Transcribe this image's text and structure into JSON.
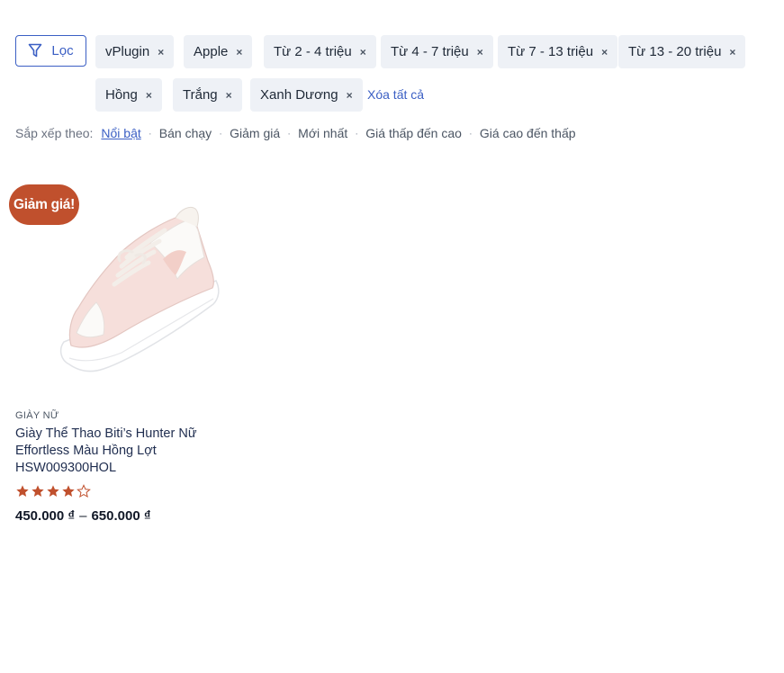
{
  "filter": {
    "label": "Lọc",
    "accent": "#3b5fc4"
  },
  "chips": [
    {
      "label": "vPlugin"
    },
    {
      "label": "Apple"
    },
    {
      "label": "Từ 2 - 4 triệu"
    },
    {
      "label": "Từ 4 - 7 triệu"
    },
    {
      "label": "Từ 7 - 13 triệu"
    },
    {
      "label": "Từ 13 - 20 triệu"
    },
    {
      "label": "Hồng"
    },
    {
      "label": "Trắng"
    },
    {
      "label": "Xanh Dương"
    }
  ],
  "remove_symbol": "×",
  "clear_all": "Xóa tất cả",
  "sort": {
    "label": "Sắp xếp theo:",
    "options": [
      "Nổi bật",
      "Bán chạy",
      "Giảm giá",
      "Mới nhất",
      "Giá thấp đến cao",
      "Giá cao đến thấp"
    ],
    "active": "Nổi bật"
  },
  "product": {
    "badge": "Giảm giá!",
    "badge_color": "#c0502d",
    "category": "GIÀY NỮ",
    "title": "Giày Thể Thao Biti’s Hunter Nữ Effortless Màu Hồng Lợt HSW009300HOL",
    "rating": 4,
    "rating_max": 5,
    "price_min": "450.000 ₫",
    "price_sep": "–",
    "price_max": "650.000 ₫"
  }
}
